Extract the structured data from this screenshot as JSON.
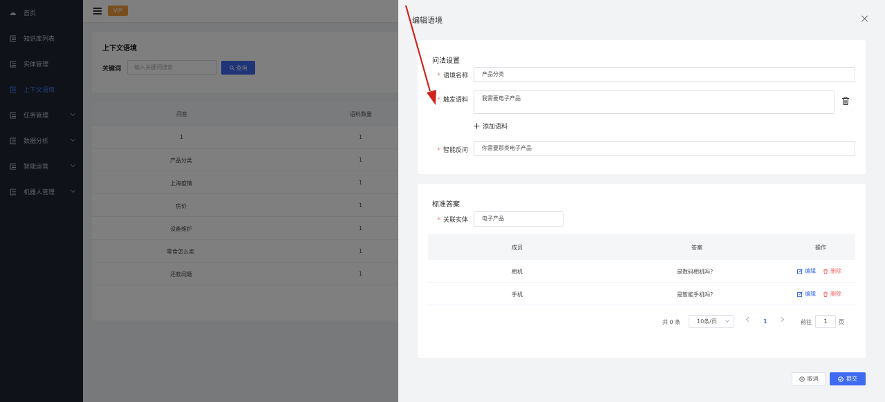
{
  "sidebar": {
    "items": [
      {
        "label": "首页",
        "icon": "dashboard-icon",
        "active": false,
        "expandable": false
      },
      {
        "label": "知识库列表",
        "icon": "list-icon",
        "active": false,
        "expandable": false
      },
      {
        "label": "实体管理",
        "icon": "list-icon",
        "active": false,
        "expandable": false
      },
      {
        "label": "上下文语境",
        "icon": "list-icon",
        "active": true,
        "expandable": false
      },
      {
        "label": "任务管理",
        "icon": "list-icon",
        "active": false,
        "expandable": true
      },
      {
        "label": "数据分析",
        "icon": "list-icon",
        "active": false,
        "expandable": true
      },
      {
        "label": "智能运营",
        "icon": "list-icon",
        "active": false,
        "expandable": true
      },
      {
        "label": "机器人管理",
        "icon": "list-icon",
        "active": false,
        "expandable": true
      }
    ]
  },
  "topbar": {
    "vip_label": "VIP"
  },
  "page": {
    "title": "上下文语境",
    "search_label": "关键词",
    "search_placeholder": "输入关键词搜索",
    "search_button": "查询",
    "table": {
      "headers": [
        "问答",
        "语料数量"
      ],
      "rows": [
        {
          "qa": "1",
          "count": "1"
        },
        {
          "qa": "产品分类",
          "count": "1"
        },
        {
          "qa": "上海疫情",
          "count": "1"
        },
        {
          "qa": "房价",
          "count": "1"
        },
        {
          "qa": "设备维护",
          "count": "1"
        },
        {
          "qa": "零食怎么卖",
          "count": "1"
        },
        {
          "qa": "还款问题",
          "count": "1"
        }
      ]
    }
  },
  "drawer": {
    "title": "编辑语境",
    "section1": {
      "title": "问法设置",
      "name_label": "语境名称",
      "name_value": "产品分类",
      "trigger_label": "触发语料",
      "trigger_value": "我需要电子产品",
      "add_label": "添加语料",
      "reply_label": "智能反问",
      "reply_value": "你需要那类电子产品"
    },
    "section2": {
      "title": "标准答案",
      "entity_label": "关联实体",
      "entity_value": "电子产品",
      "table": {
        "headers": [
          "成员",
          "答案",
          "操作"
        ],
        "rows": [
          {
            "member": "相机",
            "answer": "是数码相机吗?"
          },
          {
            "member": "手机",
            "answer": "是智能手机吗?"
          }
        ],
        "edit_label": "编辑",
        "delete_label": "删除"
      },
      "pagination": {
        "total": "共 0 条",
        "page_size": "10条/页",
        "current": "1",
        "goto_label": "前往",
        "goto_value": "1",
        "page_unit": "页"
      }
    },
    "cancel_label": "取消",
    "submit_label": "提交"
  },
  "colors": {
    "accent": "#3e6bef",
    "danger": "#f56c6c",
    "vip": "#f29d3d",
    "sidebar": "#1f2533",
    "annotation_arrow": "#d0241c"
  }
}
